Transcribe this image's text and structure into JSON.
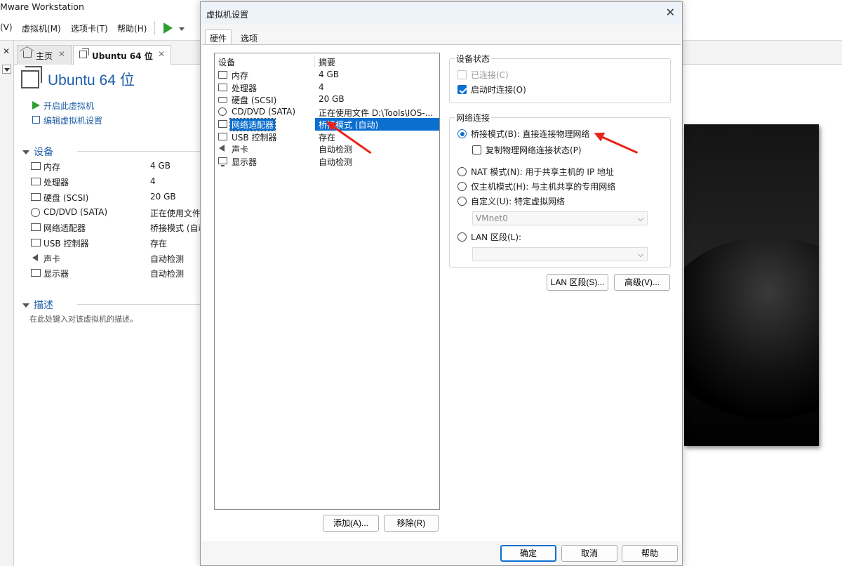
{
  "app": {
    "title": "Mware Workstation",
    "menu": [
      "(V)",
      "虚拟机(M)",
      "选项卡(T)",
      "帮助(H)"
    ],
    "tabs": [
      {
        "label": "主页"
      },
      {
        "label": "Ubuntu 64 位"
      }
    ]
  },
  "vm": {
    "title": "Ubuntu 64 位",
    "actions": [
      "开启此虚拟机",
      "编辑虚拟机设置"
    ],
    "devices_heading": "设备",
    "devices": [
      {
        "name": "内存",
        "value": "4 GB"
      },
      {
        "name": "处理器",
        "value": "4"
      },
      {
        "name": "硬盘 (SCSI)",
        "value": "20 GB"
      },
      {
        "name": "CD/DVD (SATA)",
        "value": "正在使用文件"
      },
      {
        "name": "网络适配器",
        "value": "桥接模式 (自动)"
      },
      {
        "name": "USB 控制器",
        "value": "存在"
      },
      {
        "name": "声卡",
        "value": "自动检测"
      },
      {
        "name": "显示器",
        "value": "自动检测"
      }
    ],
    "desc_heading": "描述",
    "desc_placeholder": "在此处键入对该虚拟机的描述。"
  },
  "dialog": {
    "title": "虚拟机设置",
    "tabs": [
      "硬件",
      "选项"
    ],
    "list_headers": {
      "device": "设备",
      "summary": "摘要"
    },
    "devices": [
      {
        "name": "内存",
        "summary": "4 GB"
      },
      {
        "name": "处理器",
        "summary": "4"
      },
      {
        "name": "硬盘 (SCSI)",
        "summary": "20 GB"
      },
      {
        "name": "CD/DVD (SATA)",
        "summary": "正在使用文件 D:\\Tools\\IOS-..."
      },
      {
        "name": "网络适配器",
        "summary": "桥接模式 (自动)"
      },
      {
        "name": "USB 控制器",
        "summary": "存在"
      },
      {
        "name": "声卡",
        "summary": "自动检测"
      },
      {
        "name": "显示器",
        "summary": "自动检测"
      }
    ],
    "selected_index": 4,
    "add_label": "添加(A)...",
    "remove_label": "移除(R)",
    "device_status": {
      "title": "设备状态",
      "connected": {
        "label": "已连接(C)",
        "checked": false,
        "disabled": true
      },
      "connect_at_power_on": {
        "label": "启动时连接(O)",
        "checked": true
      }
    },
    "network": {
      "title": "网络连接",
      "options": [
        {
          "label": "桥接模式(B): 直接连接物理网络",
          "selected": true
        },
        {
          "label": "NAT 模式(N): 用于共享主机的 IP 地址",
          "selected": false
        },
        {
          "label": "仅主机模式(H): 与主机共享的专用网络",
          "selected": false
        },
        {
          "label": "自定义(U): 特定虚拟网络",
          "selected": false
        },
        {
          "label": "LAN 区段(L):",
          "selected": false
        }
      ],
      "replicate_label": "复制物理网络连接状态(P)",
      "replicate_checked": false,
      "custom_value": "VMnet0",
      "lan_value": ""
    },
    "lan_segments_button": "LAN 区段(S)...",
    "advanced_button": "高级(V)...",
    "ok_label": "确定",
    "cancel_label": "取消",
    "help_label": "帮助"
  },
  "colors": {
    "accent": "#0b6fd0",
    "annotation_arrow": "#e8231c",
    "link": "#1f5fa8"
  }
}
